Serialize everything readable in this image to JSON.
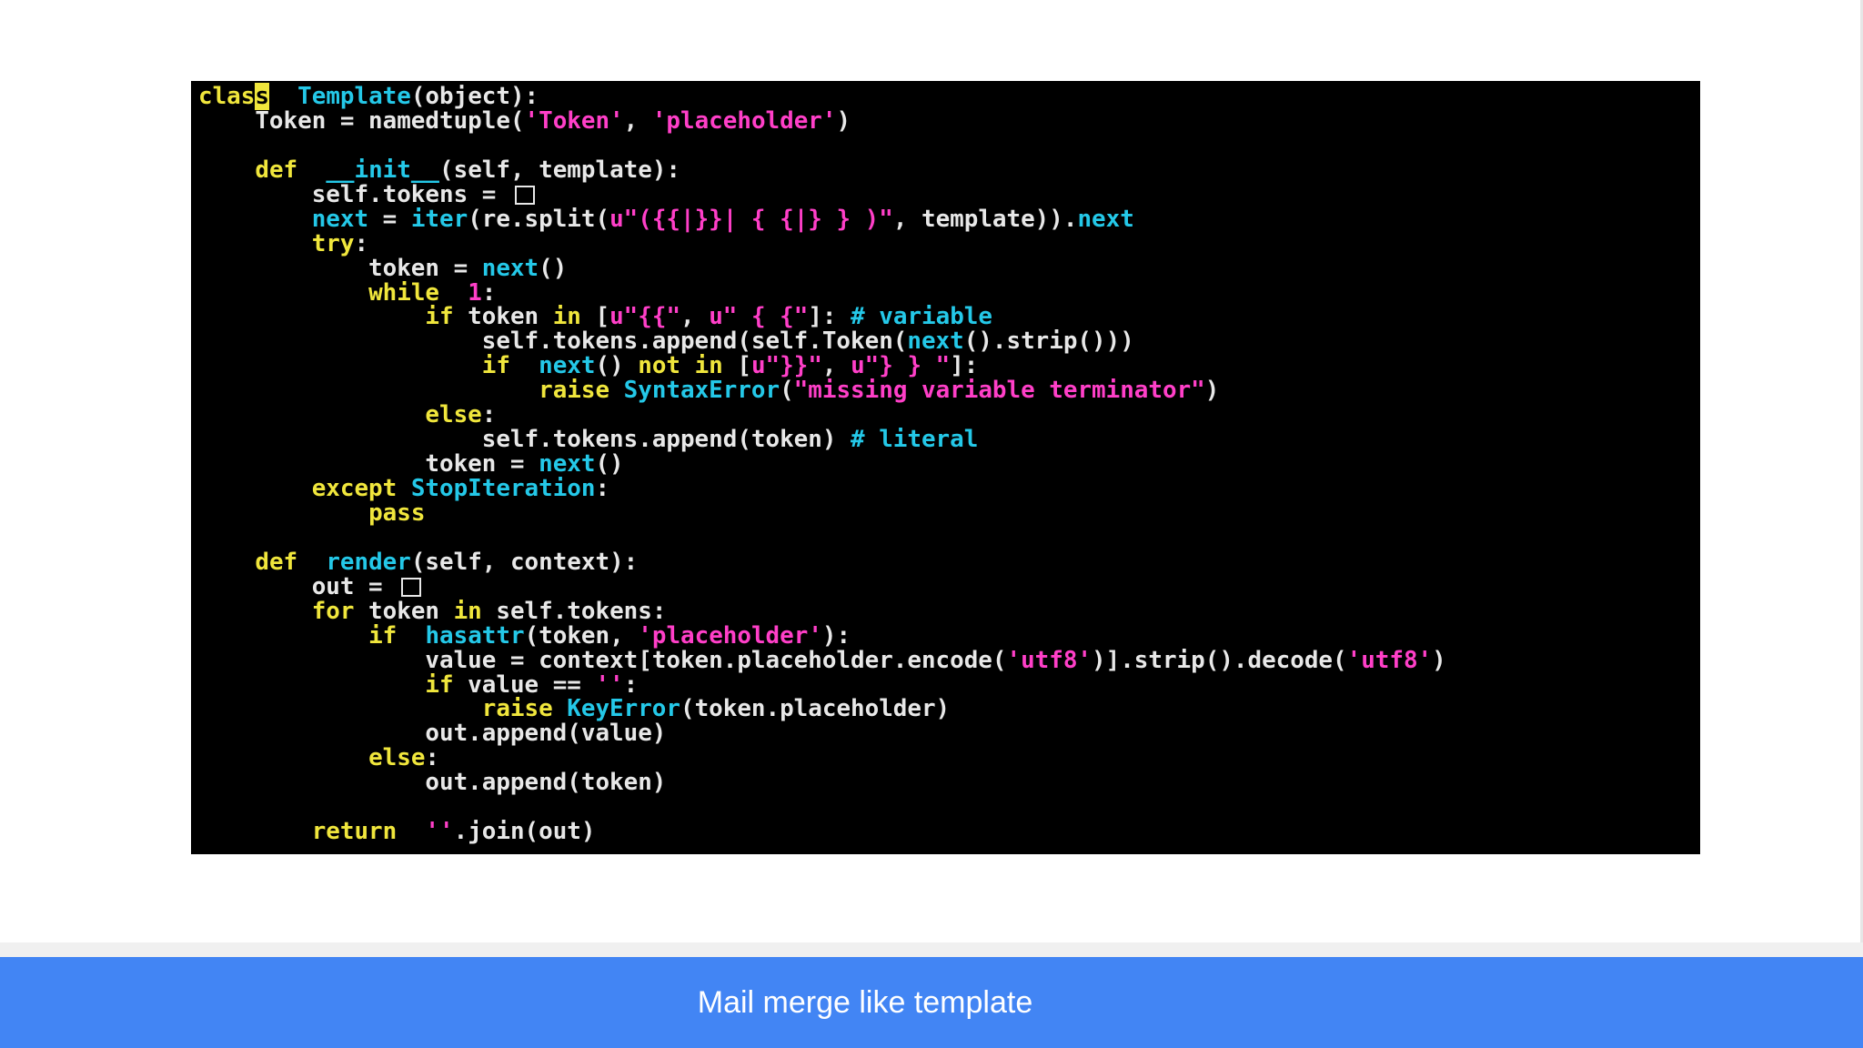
{
  "colors": {
    "page_background": "#ffffff",
    "code_background": "#000000",
    "code_default": "#e8e8e8",
    "keyword": "#f0e63c",
    "function": "#24c8e8",
    "string": "#ff3fc8",
    "comment": "#24c8e8",
    "caption_background": "#4285f4",
    "caption_text": "#ffffff"
  },
  "code": {
    "language": "python",
    "lines": [
      [
        [
          "kw",
          "clas"
        ],
        [
          "cur",
          "s"
        ],
        [
          "",
          "  "
        ],
        [
          "fn",
          "Template"
        ],
        [
          "",
          "(object):"
        ]
      ],
      [
        [
          "",
          "    Token = namedtuple("
        ],
        [
          "str",
          "'Token'"
        ],
        [
          "",
          ", "
        ],
        [
          "str",
          "'placeholder'"
        ],
        [
          "",
          ")"
        ]
      ],
      [],
      [
        [
          "",
          "    "
        ],
        [
          "kw",
          "def"
        ],
        [
          "",
          "  "
        ],
        [
          "fn",
          "__init__"
        ],
        [
          "",
          "(self, template):"
        ]
      ],
      [
        [
          "",
          "        self.tokens = "
        ],
        [
          "box",
          ""
        ]
      ],
      [
        [
          "",
          "        "
        ],
        [
          "fn",
          "next"
        ],
        [
          "",
          " = "
        ],
        [
          "fn",
          "iter"
        ],
        [
          "",
          "(re.split("
        ],
        [
          "str",
          "u\"({{|}}| { {|} } )\""
        ],
        [
          "",
          ", template))."
        ],
        [
          "fn",
          "next"
        ]
      ],
      [
        [
          "",
          "        "
        ],
        [
          "kw",
          "try"
        ],
        [
          "",
          ":"
        ]
      ],
      [
        [
          "",
          "            token = "
        ],
        [
          "fn",
          "next"
        ],
        [
          "",
          "()"
        ]
      ],
      [
        [
          "",
          "            "
        ],
        [
          "kw",
          "while"
        ],
        [
          "",
          "  "
        ],
        [
          "num",
          "1"
        ],
        [
          "",
          ":"
        ]
      ],
      [
        [
          "",
          "                "
        ],
        [
          "kw",
          "if"
        ],
        [
          "",
          " token "
        ],
        [
          "kw",
          "in"
        ],
        [
          "",
          " ["
        ],
        [
          "str",
          "u\"{{\""
        ],
        [
          "",
          ", "
        ],
        [
          "str",
          "u\" { {\""
        ],
        [
          "",
          "]: "
        ],
        [
          "cm",
          "# variable"
        ]
      ],
      [
        [
          "",
          "                    self.tokens.append(self.Token("
        ],
        [
          "fn",
          "next"
        ],
        [
          "",
          "().strip()))"
        ]
      ],
      [
        [
          "",
          "                    "
        ],
        [
          "kw",
          "if"
        ],
        [
          "",
          "  "
        ],
        [
          "fn",
          "next"
        ],
        [
          "",
          "() "
        ],
        [
          "kw",
          "not in"
        ],
        [
          "",
          " ["
        ],
        [
          "str",
          "u\"}}\""
        ],
        [
          "",
          ", "
        ],
        [
          "str",
          "u\"} } \""
        ],
        [
          "",
          "]:"
        ]
      ],
      [
        [
          "",
          "                        "
        ],
        [
          "kw",
          "raise"
        ],
        [
          "",
          " "
        ],
        [
          "fn",
          "SyntaxError"
        ],
        [
          "",
          "("
        ],
        [
          "str",
          "\"missing variable terminator\""
        ],
        [
          "",
          ")"
        ]
      ],
      [
        [
          "",
          "                "
        ],
        [
          "kw",
          "else"
        ],
        [
          "",
          ":"
        ]
      ],
      [
        [
          "",
          "                    self.tokens.append(token) "
        ],
        [
          "cm",
          "# literal"
        ]
      ],
      [
        [
          "",
          "                token = "
        ],
        [
          "fn",
          "next"
        ],
        [
          "",
          "()"
        ]
      ],
      [
        [
          "",
          "        "
        ],
        [
          "kw",
          "except"
        ],
        [
          "",
          " "
        ],
        [
          "fn",
          "StopIteration"
        ],
        [
          "",
          ":"
        ]
      ],
      [
        [
          "",
          "            "
        ],
        [
          "kw",
          "pass"
        ]
      ],
      [],
      [
        [
          "",
          "    "
        ],
        [
          "kw",
          "def"
        ],
        [
          "",
          "  "
        ],
        [
          "fn",
          "render"
        ],
        [
          "",
          "(self, context):"
        ]
      ],
      [
        [
          "",
          "        out = "
        ],
        [
          "box",
          ""
        ]
      ],
      [
        [
          "",
          "        "
        ],
        [
          "kw",
          "for"
        ],
        [
          "",
          " token "
        ],
        [
          "kw",
          "in"
        ],
        [
          "",
          " self.tokens:"
        ]
      ],
      [
        [
          "",
          "            "
        ],
        [
          "kw",
          "if"
        ],
        [
          "",
          "  "
        ],
        [
          "fn",
          "hasattr"
        ],
        [
          "",
          "(token, "
        ],
        [
          "str",
          "'placeholder'"
        ],
        [
          "",
          "):"
        ]
      ],
      [
        [
          "",
          "                value = context[token.placeholder.encode("
        ],
        [
          "str",
          "'utf8'"
        ],
        [
          "",
          ")].strip().decode("
        ],
        [
          "str",
          "'utf8'"
        ],
        [
          "",
          ")"
        ]
      ],
      [
        [
          "",
          "                "
        ],
        [
          "kw",
          "if"
        ],
        [
          "",
          " value == "
        ],
        [
          "str",
          "''"
        ],
        [
          "",
          ":"
        ]
      ],
      [
        [
          "",
          "                    "
        ],
        [
          "kw",
          "raise"
        ],
        [
          "",
          " "
        ],
        [
          "fn",
          "KeyError"
        ],
        [
          "",
          "(token.placeholder)"
        ]
      ],
      [
        [
          "",
          "                out.append(value)"
        ]
      ],
      [
        [
          "",
          "            "
        ],
        [
          "kw",
          "else"
        ],
        [
          "",
          ":"
        ]
      ],
      [
        [
          "",
          "                out.append(token)"
        ]
      ],
      [],
      [
        [
          "",
          "        "
        ],
        [
          "kw",
          "return"
        ],
        [
          "",
          "  "
        ],
        [
          "str",
          "''"
        ],
        [
          "",
          ".join(out)"
        ]
      ]
    ]
  },
  "caption": {
    "text": "Mail merge like template"
  }
}
